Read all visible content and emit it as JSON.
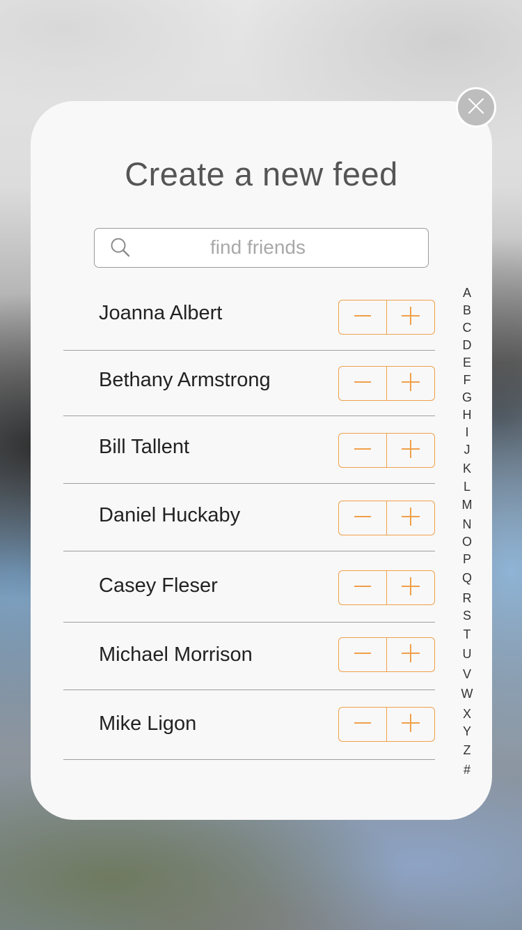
{
  "dialog": {
    "title": "Create a new feed",
    "close_icon": "close-x-icon"
  },
  "search": {
    "placeholder": "find friends",
    "value": "",
    "icon": "search-icon"
  },
  "friends": [
    {
      "name": "Joanna Albert"
    },
    {
      "name": "Bethany Armstrong"
    },
    {
      "name": "Bill Tallent"
    },
    {
      "name": "Daniel Huckaby"
    },
    {
      "name": "Casey Fleser"
    },
    {
      "name": "Michael Morrison"
    },
    {
      "name": "Mike Ligon"
    }
  ],
  "stepper": {
    "minus_icon": "minus-icon",
    "plus_icon": "plus-icon"
  },
  "index": [
    "A",
    "B",
    "C",
    "D",
    "E",
    "F",
    "G",
    "H",
    "I",
    "J",
    "K",
    "L",
    "M",
    "N",
    "O",
    "P",
    "Q",
    "R",
    "S",
    "T",
    "U",
    "V",
    "W",
    "X",
    "Y",
    "Z",
    "#"
  ],
  "colors": {
    "accent": "#f0a04a",
    "sheet_bg": "#f8f8f8",
    "close_bg": "#bdbdbd"
  }
}
